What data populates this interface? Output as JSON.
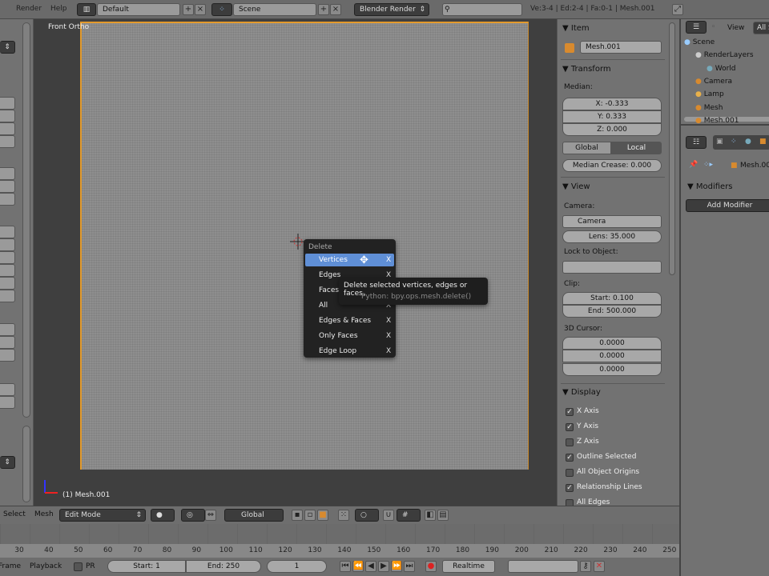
{
  "topbar": {
    "menus": [
      "Render",
      "Help"
    ],
    "screen_layout": "Default",
    "scene": "Scene",
    "engine": "Blender Render",
    "stats": "Ve:3-4 | Ed:2-4 | Fa:0-1 | Mesh.001"
  },
  "viewport": {
    "view_name": "Front Ortho",
    "object_label": "(1) Mesh.001"
  },
  "delete_menu": {
    "title": "Delete",
    "items": [
      {
        "label": "Vertices",
        "shortcut": "X"
      },
      {
        "label": "Edges",
        "shortcut": "X"
      },
      {
        "label": "Faces",
        "shortcut": "X"
      },
      {
        "label": "All",
        "shortcut": "X"
      },
      {
        "label": "Edges & Faces",
        "shortcut": "X"
      },
      {
        "label": "Only Faces",
        "shortcut": "X"
      },
      {
        "label": "Edge Loop",
        "shortcut": "X"
      }
    ],
    "tooltip": "Delete selected vertices, edges or faces.",
    "tooltip_python": "Python: bpy.ops.mesh.delete()"
  },
  "npanel": {
    "item_header": "Item",
    "item_name": "Mesh.001",
    "transform_header": "Transform",
    "median_label": "Median:",
    "x": "X: -0.333",
    "y": "Y: 0.333",
    "z": "Z: 0.000",
    "global": "Global",
    "local": "Local",
    "median_crease": "Median Crease: 0.000",
    "view_header": "View",
    "camera_label": "Camera:",
    "camera": "Camera",
    "lens": "Lens: 35.000",
    "lock_label": "Lock to Object:",
    "clip_label": "Clip:",
    "clip_start": "Start: 0.100",
    "clip_end": "End: 500.000",
    "cursor_label": "3D Cursor:",
    "cursor": [
      "0.0000",
      "0.0000",
      "0.0000"
    ],
    "display_header": "Display",
    "display": [
      {
        "label": "X Axis",
        "checked": true
      },
      {
        "label": "Y Axis",
        "checked": true
      },
      {
        "label": "Z Axis",
        "checked": false
      },
      {
        "label": "Outline Selected",
        "checked": true
      },
      {
        "label": "All Object Origins",
        "checked": false
      },
      {
        "label": "Relationship Lines",
        "checked": true
      },
      {
        "label": "All Edges",
        "checked": false
      }
    ]
  },
  "outliner": {
    "view_menu": "View",
    "filter": "All S",
    "items": [
      "Scene",
      "RenderLayers",
      "World",
      "Camera",
      "Lamp",
      "Mesh",
      "Mesh.001"
    ]
  },
  "properties": {
    "object_name": "Mesh.00",
    "modifiers_header": "Modifiers",
    "add_modifier": "Add Modifier"
  },
  "header3d": {
    "menus": [
      "Select",
      "Mesh"
    ],
    "mode": "Edit Mode",
    "orientation": "Global"
  },
  "timeline": {
    "ticks": [
      "30",
      "40",
      "50",
      "60",
      "70",
      "80",
      "90",
      "100",
      "110",
      "120",
      "130",
      "140",
      "150",
      "160",
      "170",
      "180",
      "190",
      "200",
      "210",
      "220",
      "230",
      "240",
      "250"
    ],
    "menus": [
      "Frame",
      "Playback"
    ],
    "pr_label": "PR",
    "start": "Start: 1",
    "end": "End: 250",
    "current": "1",
    "sync": "Realtime"
  }
}
